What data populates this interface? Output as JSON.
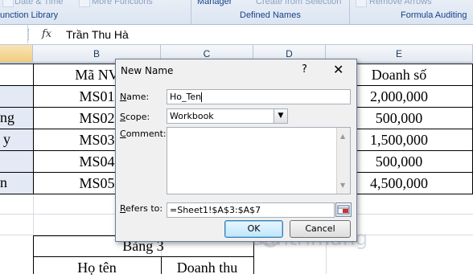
{
  "ribbon": {
    "faint_left": "Date & Time",
    "faint_mid": "More Functions",
    "manager": "Manager",
    "create_from_selection": "Create from Selection",
    "remove_arrows": "Remove Arrows",
    "group_function_library": "unction Library",
    "group_defined_names": "Defined Names",
    "group_formula_auditing": "Formula Auditing"
  },
  "formula_bar": {
    "fx": "fx",
    "content": "Trần Thu Hà"
  },
  "columns": [
    "B",
    "C",
    "D",
    "E"
  ],
  "sheet": {
    "col_a_fragments": [
      "ng",
      "y",
      "n"
    ],
    "header_b": "Mã NV",
    "header_e": "Doanh số",
    "codes": [
      "MS01",
      "MS02",
      "MS03",
      "MS04",
      "MS05"
    ],
    "sales": [
      "2,000,000",
      "500,000",
      "1,500,000",
      "500,000",
      "4,500,000"
    ],
    "table3_title": "Bảng 3",
    "table3_col1": "Họ tên",
    "table3_col2": "Doanh thu"
  },
  "dialog": {
    "title": "New Name",
    "help": "?",
    "close": "✕",
    "name_label_u": "N",
    "name_label_rest": "ame:",
    "name_value": "Ho_Ten",
    "scope_label_u": "S",
    "scope_label_rest": "cope:",
    "scope_value": "Workbook",
    "comment_label_u": "C",
    "comment_label_rest": "omment:",
    "refers_label_u": "R",
    "refers_label_rest": "efers to:",
    "refers_value": "=Sheet1!$A$3:$A$7",
    "ok_label": "OK",
    "cancel_label": "Cancel"
  },
  "watermark": "uantrimang",
  "colors": {
    "accent": "#15428b",
    "selected_header": "#f2cd7e",
    "dialog_bg": "#f0f0f0"
  }
}
